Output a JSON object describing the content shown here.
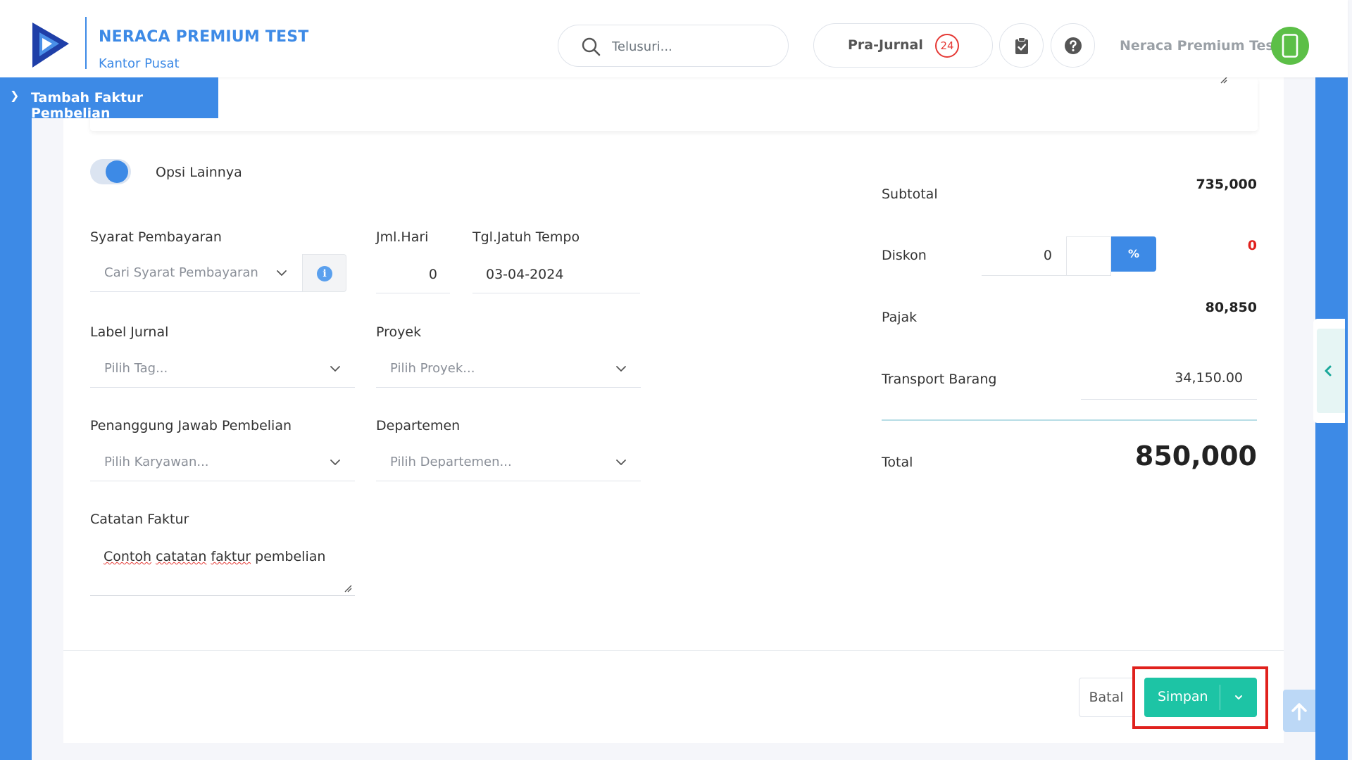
{
  "header": {
    "company_name": "NERACA PREMIUM TEST",
    "company_branch": "Kantor Pusat",
    "search_placeholder": "Telusuri...",
    "prajurnal_label": "Pra-Jurnal",
    "prajurnal_count": "24",
    "user_name": "Neraca Premium Test",
    "brand_color": "#3d8ae6"
  },
  "page": {
    "title": "Tambah Faktur Pembelian"
  },
  "form": {
    "opsi_lainnya_label": "Opsi Lainnya",
    "opsi_lainnya_on": true,
    "syarat_pembayaran": {
      "label": "Syarat Pembayaran",
      "placeholder": "Cari Syarat Pembayaran..."
    },
    "jml_hari": {
      "label": "Jml.Hari",
      "value": "0"
    },
    "tgl_jatuh_tempo": {
      "label": "Tgl.Jatuh Tempo",
      "value": "03-04-2024"
    },
    "label_jurnal": {
      "label": "Label Jurnal",
      "placeholder": "Pilih Tag..."
    },
    "proyek": {
      "label": "Proyek",
      "placeholder": "Pilih Proyek..."
    },
    "penanggung_jawab": {
      "label": "Penanggung Jawab Pembelian",
      "placeholder": "Pilih Karyawan..."
    },
    "departemen": {
      "label": "Departemen",
      "placeholder": "Pilih Departemen..."
    },
    "catatan_faktur": {
      "label": "Catatan Faktur",
      "value_word1": "Contoh",
      "value_word2": "catatan",
      "value_word3": "faktur",
      "value_rest": "pembelian"
    }
  },
  "summary": {
    "subtotal_label": "Subtotal",
    "subtotal_value": "735,000",
    "diskon_label": "Diskon",
    "diskon_input": "0",
    "diskon_unit": "%",
    "diskon_value": "0",
    "diskon_value_color": "#e0211d",
    "pajak_label": "Pajak",
    "pajak_value": "80,850",
    "transport_label": "Transport Barang",
    "transport_value": "34,150.00",
    "total_label": "Total",
    "total_value": "850,000"
  },
  "footer": {
    "batal_label": "Batal",
    "simpan_label": "Simpan",
    "simpan_color": "#1dc4a5"
  }
}
